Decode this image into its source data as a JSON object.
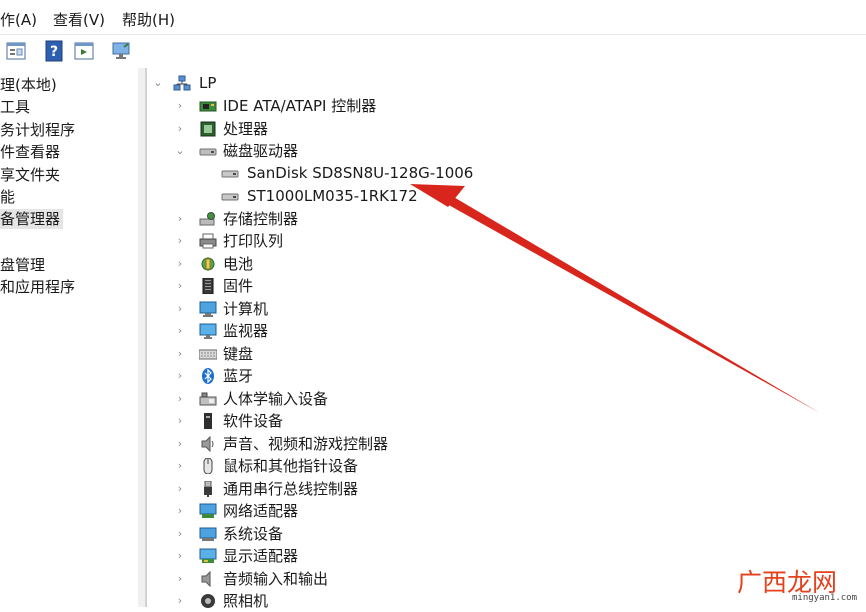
{
  "menubar": {
    "items": [
      {
        "label": "作(A)"
      },
      {
        "label": "查看(V)"
      },
      {
        "label": "帮助(H)"
      }
    ]
  },
  "toolbar": {
    "buttons": [
      {
        "icon": "properties-icon"
      },
      {
        "icon": "help-icon"
      },
      {
        "icon": "run-icon"
      },
      {
        "icon": "monitor-icon"
      }
    ]
  },
  "left_nav": {
    "items": [
      {
        "label": "理(本地)"
      },
      {
        "label": "工具"
      },
      {
        "label": "务计划程序"
      },
      {
        "label": "件查看器"
      },
      {
        "label": "享文件夹"
      },
      {
        "label": "能"
      },
      {
        "label": "备管理器",
        "selected": true
      },
      {
        "label": "盘管理"
      },
      {
        "label": "和应用程序"
      }
    ]
  },
  "tree": {
    "root": {
      "label": "LP"
    },
    "nodes": [
      {
        "label": "IDE ATA/ATAPI 控制器",
        "icon": "ide-controller-icon"
      },
      {
        "label": "处理器",
        "icon": "processor-icon"
      },
      {
        "label": "磁盘驱动器",
        "icon": "disk-drive-icon",
        "expanded": true,
        "children": [
          {
            "label": "SanDisk SD8SN8U-128G-1006",
            "icon": "disk-icon"
          },
          {
            "label": "ST1000LM035-1RK172",
            "icon": "disk-icon"
          }
        ]
      },
      {
        "label": "存储控制器",
        "icon": "storage-controller-icon"
      },
      {
        "label": "打印队列",
        "icon": "printer-icon"
      },
      {
        "label": "电池",
        "icon": "battery-icon"
      },
      {
        "label": "固件",
        "icon": "firmware-icon"
      },
      {
        "label": "计算机",
        "icon": "computer-icon"
      },
      {
        "label": "监视器",
        "icon": "monitor-icon"
      },
      {
        "label": "键盘",
        "icon": "keyboard-icon"
      },
      {
        "label": "蓝牙",
        "icon": "bluetooth-icon"
      },
      {
        "label": "人体学输入设备",
        "icon": "hid-icon"
      },
      {
        "label": "软件设备",
        "icon": "software-device-icon"
      },
      {
        "label": "声音、视频和游戏控制器",
        "icon": "sound-icon"
      },
      {
        "label": "鼠标和其他指针设备",
        "icon": "mouse-icon"
      },
      {
        "label": "通用串行总线控制器",
        "icon": "usb-icon"
      },
      {
        "label": "网络适配器",
        "icon": "network-adapter-icon"
      },
      {
        "label": "系统设备",
        "icon": "system-device-icon"
      },
      {
        "label": "显示适配器",
        "icon": "display-adapter-icon"
      },
      {
        "label": "音频输入和输出",
        "icon": "audio-io-icon"
      },
      {
        "label": "照相机",
        "icon": "camera-icon"
      }
    ]
  },
  "annotation": {
    "color": "#d9261c"
  },
  "watermark": {
    "text": "广西龙网",
    "url": "mingyan1.com",
    "color": "#e5411c"
  }
}
